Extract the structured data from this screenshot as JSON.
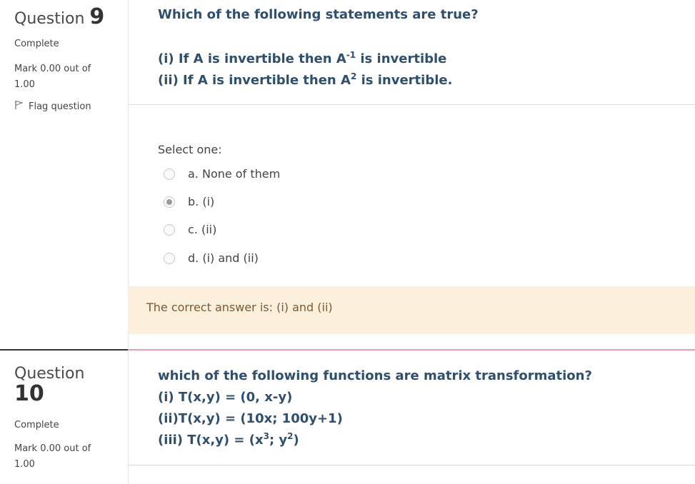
{
  "question9": {
    "label": "Question",
    "number": "9",
    "state": "Complete",
    "mark": "Mark 0.00 out of 1.00",
    "flag_label": "Flag question",
    "title": "Which of the following statements are true?",
    "statement1_pre": "(i) If A is invertible then A",
    "statement1_sup": "-1",
    "statement1_post": " is invertible",
    "statement2_pre": "(ii) If A is invertible then A",
    "statement2_sup": "2",
    "statement2_post": " is invertible.",
    "prompt": "Select one:",
    "options": [
      {
        "label": "a. None of them",
        "checked": false
      },
      {
        "label": "b. (i)",
        "checked": true
      },
      {
        "label": "c. (ii)",
        "checked": false
      },
      {
        "label": "d. (i) and (ii)",
        "checked": false
      }
    ],
    "feedback": "The correct answer is: (i) and (ii)"
  },
  "question10": {
    "label": "Question",
    "number": "10",
    "state": "Complete",
    "mark": "Mark 0.00 out of 1.00",
    "title": "which of the following functions are matrix transformation?",
    "line1": "(i) T(x,y) = (0, x-y)",
    "line2": "(ii)T(x,y) = (10x; 100y+1)",
    "line3_pre": "(iii) T(x,y) = (x",
    "line3_sup1": "3",
    "line3_mid": "; y",
    "line3_sup2": "2",
    "line3_post": ")"
  },
  "colors": {
    "question_text": "#2f4f6f",
    "feedback_bg": "#fcefdc",
    "feedback_text": "#7a5a35",
    "separator_accent": "#e8a0a8"
  },
  "icons": {
    "flag": "flag-icon",
    "radio": "radio-icon"
  }
}
